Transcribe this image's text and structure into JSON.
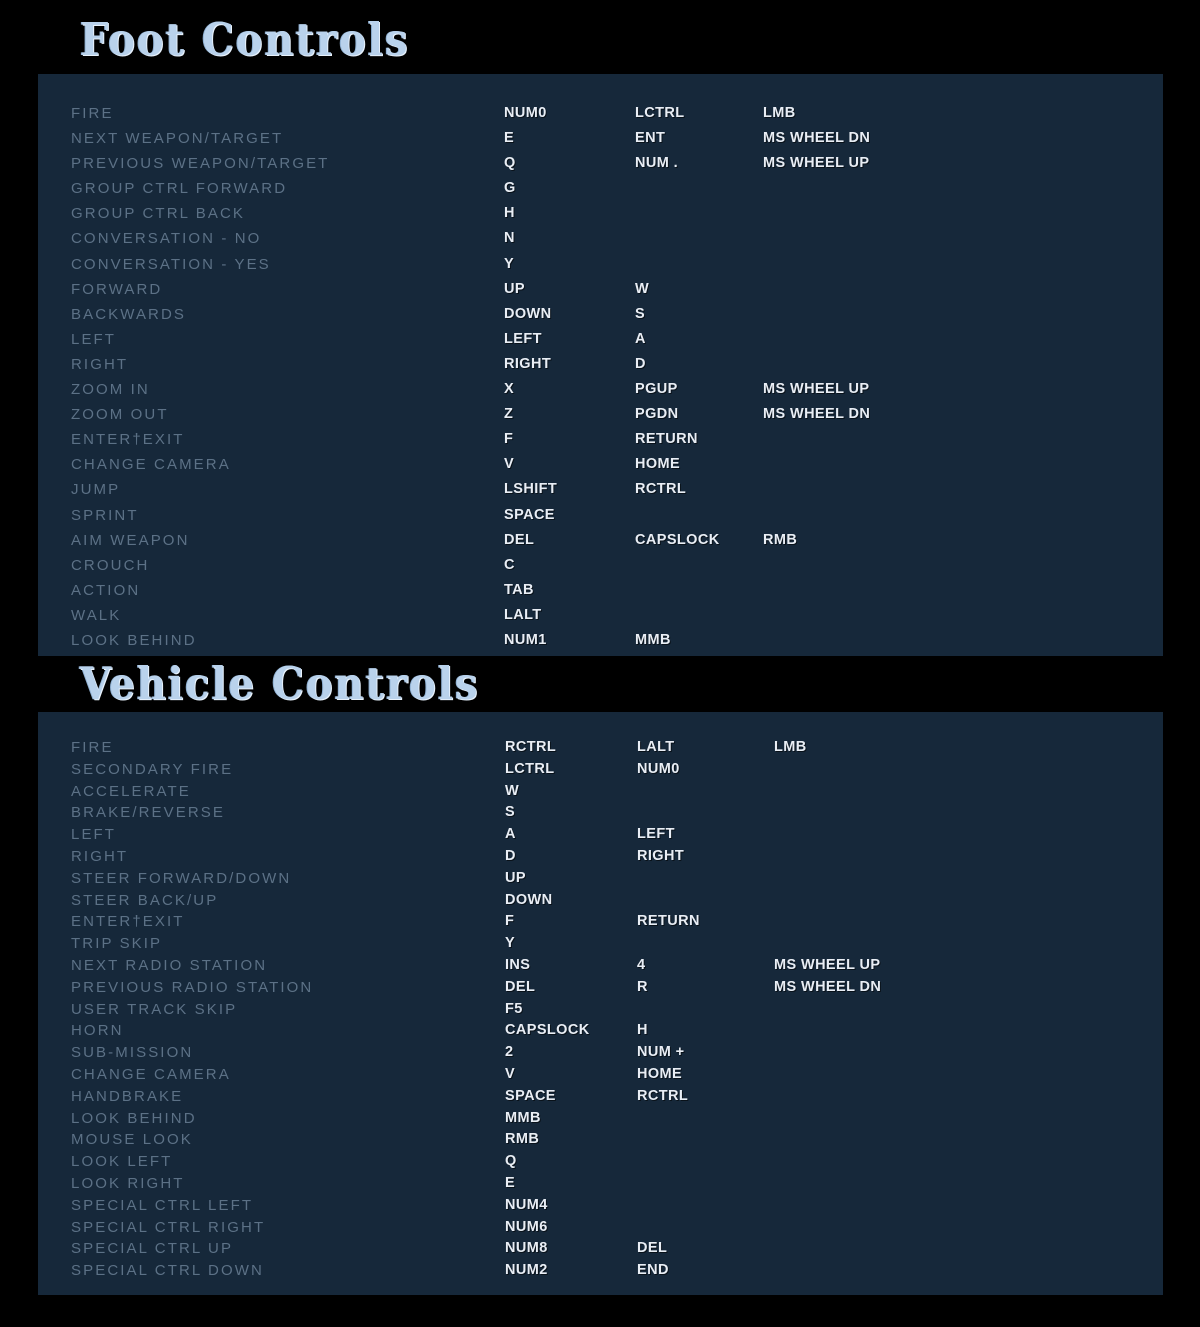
{
  "colors": {
    "page_background": "#000000",
    "panel_background": "#16283a",
    "title_text": "#b9d2ec",
    "action_label": "#5c7186",
    "key_text": "#e9eef5"
  },
  "sections": [
    {
      "id": "foot",
      "title": "Foot Controls",
      "rows": [
        {
          "action": "FIRE",
          "keys": [
            "NUM0",
            "LCTRL",
            "LMB"
          ]
        },
        {
          "action": "NEXT WEAPON/TARGET",
          "keys": [
            "E",
            "ENT",
            "MS WHEEL DN"
          ]
        },
        {
          "action": "PREVIOUS WEAPON/TARGET",
          "keys": [
            "Q",
            "NUM .",
            "MS WHEEL UP"
          ]
        },
        {
          "action": "GROUP CTRL FORWARD",
          "keys": [
            "G",
            "",
            ""
          ]
        },
        {
          "action": "GROUP CTRL BACK",
          "keys": [
            "H",
            "",
            ""
          ]
        },
        {
          "action": "CONVERSATION - NO",
          "keys": [
            "N",
            "",
            ""
          ]
        },
        {
          "action": "CONVERSATION - YES",
          "keys": [
            "Y",
            "",
            ""
          ]
        },
        {
          "action": "FORWARD",
          "keys": [
            "UP",
            "W",
            ""
          ]
        },
        {
          "action": "BACKWARDS",
          "keys": [
            "DOWN",
            "S",
            ""
          ]
        },
        {
          "action": "LEFT",
          "keys": [
            "LEFT",
            "A",
            ""
          ]
        },
        {
          "action": "RIGHT",
          "keys": [
            "RIGHT",
            "D",
            ""
          ]
        },
        {
          "action": "ZOOM IN",
          "keys": [
            "X",
            "PGUP",
            "MS WHEEL UP"
          ]
        },
        {
          "action": "ZOOM OUT",
          "keys": [
            "Z",
            "PGDN",
            "MS WHEEL DN"
          ]
        },
        {
          "action": "ENTER†EXIT",
          "keys": [
            "F",
            "RETURN",
            ""
          ]
        },
        {
          "action": "CHANGE CAMERA",
          "keys": [
            "V",
            "HOME",
            ""
          ]
        },
        {
          "action": "JUMP",
          "keys": [
            "LSHIFT",
            "RCTRL",
            ""
          ]
        },
        {
          "action": "SPRINT",
          "keys": [
            "SPACE",
            "",
            ""
          ]
        },
        {
          "action": "AIM WEAPON",
          "keys": [
            "DEL",
            "CAPSLOCK",
            "RMB"
          ]
        },
        {
          "action": "CROUCH",
          "keys": [
            "C",
            "",
            ""
          ]
        },
        {
          "action": "ACTION",
          "keys": [
            "TAB",
            "",
            ""
          ]
        },
        {
          "action": "WALK",
          "keys": [
            "LALT",
            "",
            ""
          ]
        },
        {
          "action": "LOOK BEHIND",
          "keys": [
            "NUM1",
            "MMB",
            ""
          ]
        }
      ]
    },
    {
      "id": "vehicle",
      "title": "Vehicle Controls",
      "rows": [
        {
          "action": "FIRE",
          "keys": [
            "RCTRL",
            "LALT",
            "LMB"
          ]
        },
        {
          "action": "SECONDARY FIRE",
          "keys": [
            "LCTRL",
            "NUM0",
            ""
          ]
        },
        {
          "action": "ACCELERATE",
          "keys": [
            "W",
            "",
            ""
          ]
        },
        {
          "action": "BRAKE/REVERSE",
          "keys": [
            "S",
            "",
            ""
          ]
        },
        {
          "action": "LEFT",
          "keys": [
            "A",
            "LEFT",
            ""
          ]
        },
        {
          "action": "RIGHT",
          "keys": [
            "D",
            "RIGHT",
            ""
          ]
        },
        {
          "action": "STEER FORWARD/DOWN",
          "keys": [
            "UP",
            "",
            ""
          ]
        },
        {
          "action": "STEER BACK/UP",
          "keys": [
            "DOWN",
            "",
            ""
          ]
        },
        {
          "action": "ENTER†EXIT",
          "keys": [
            "F",
            "RETURN",
            ""
          ]
        },
        {
          "action": "TRIP SKIP",
          "keys": [
            "Y",
            "",
            ""
          ]
        },
        {
          "action": "NEXT RADIO STATION",
          "keys": [
            "INS",
            "4",
            "MS WHEEL UP"
          ]
        },
        {
          "action": "PREVIOUS RADIO STATION",
          "keys": [
            "DEL",
            "R",
            "MS WHEEL DN"
          ]
        },
        {
          "action": "USER TRACK SKIP",
          "keys": [
            "F5",
            "",
            ""
          ]
        },
        {
          "action": "HORN",
          "keys": [
            "CAPSLOCK",
            "H",
            ""
          ]
        },
        {
          "action": "SUB-MISSION",
          "keys": [
            "2",
            "NUM +",
            ""
          ]
        },
        {
          "action": "CHANGE CAMERA",
          "keys": [
            "V",
            "HOME",
            ""
          ]
        },
        {
          "action": "HANDBRAKE",
          "keys": [
            "SPACE",
            "RCTRL",
            ""
          ]
        },
        {
          "action": "LOOK BEHIND",
          "keys": [
            "MMB",
            "",
            ""
          ]
        },
        {
          "action": "MOUSE LOOK",
          "keys": [
            "RMB",
            "",
            ""
          ]
        },
        {
          "action": "LOOK LEFT",
          "keys": [
            "Q",
            "",
            ""
          ]
        },
        {
          "action": "LOOK RIGHT",
          "keys": [
            "E",
            "",
            ""
          ]
        },
        {
          "action": "SPECIAL CTRL LEFT",
          "keys": [
            "NUM4",
            "",
            ""
          ]
        },
        {
          "action": "SPECIAL CTRL RIGHT",
          "keys": [
            "NUM6",
            "",
            ""
          ]
        },
        {
          "action": "SPECIAL CTRL UP",
          "keys": [
            "NUM8",
            "DEL",
            ""
          ]
        },
        {
          "action": "SPECIAL CTRL DOWN",
          "keys": [
            "NUM2",
            "END",
            ""
          ]
        }
      ]
    }
  ]
}
